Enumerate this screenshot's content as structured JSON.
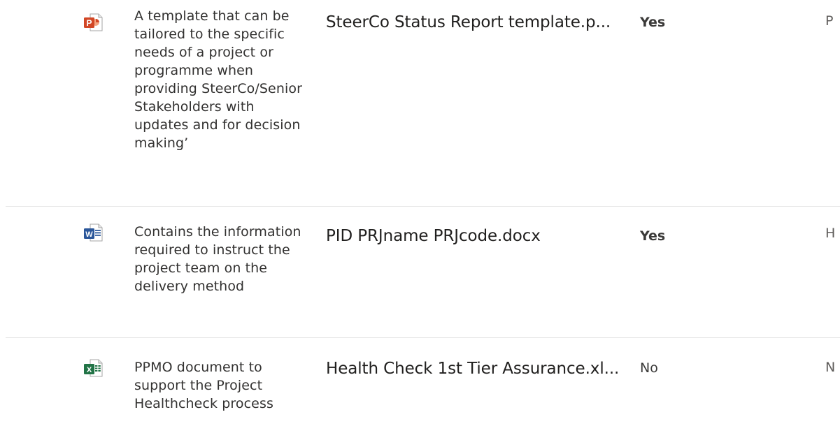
{
  "colors": {
    "powerpoint": "#D24726",
    "word": "#2B579A",
    "excel": "#217346",
    "divider": "#E6E6E6",
    "text": "#323130"
  },
  "rows": [
    {
      "file_type_icon": "powerpoint-file-icon",
      "icon_letter": "P",
      "description": "A template that can be tailored to the specific needs of a project or programme when providing SteerCo/Senior Stakeholders with updates and for decision making’",
      "file_name": "SteerCo Status Report template.p...",
      "flag": "Yes",
      "next_column_partial": "P"
    },
    {
      "file_type_icon": "word-file-icon",
      "icon_letter": "W",
      "description": "Contains the information required to instruct the project team on the delivery method",
      "file_name": "PID PRJname PRJcode.docx",
      "flag": "Yes",
      "next_column_partial": "H"
    },
    {
      "file_type_icon": "excel-file-icon",
      "icon_letter": "X",
      "description": "PPMO document to support the Project Healthcheck process",
      "file_name": "Health Check 1st Tier Assurance.xl...",
      "flag": "No",
      "next_column_partial": "N"
    }
  ]
}
